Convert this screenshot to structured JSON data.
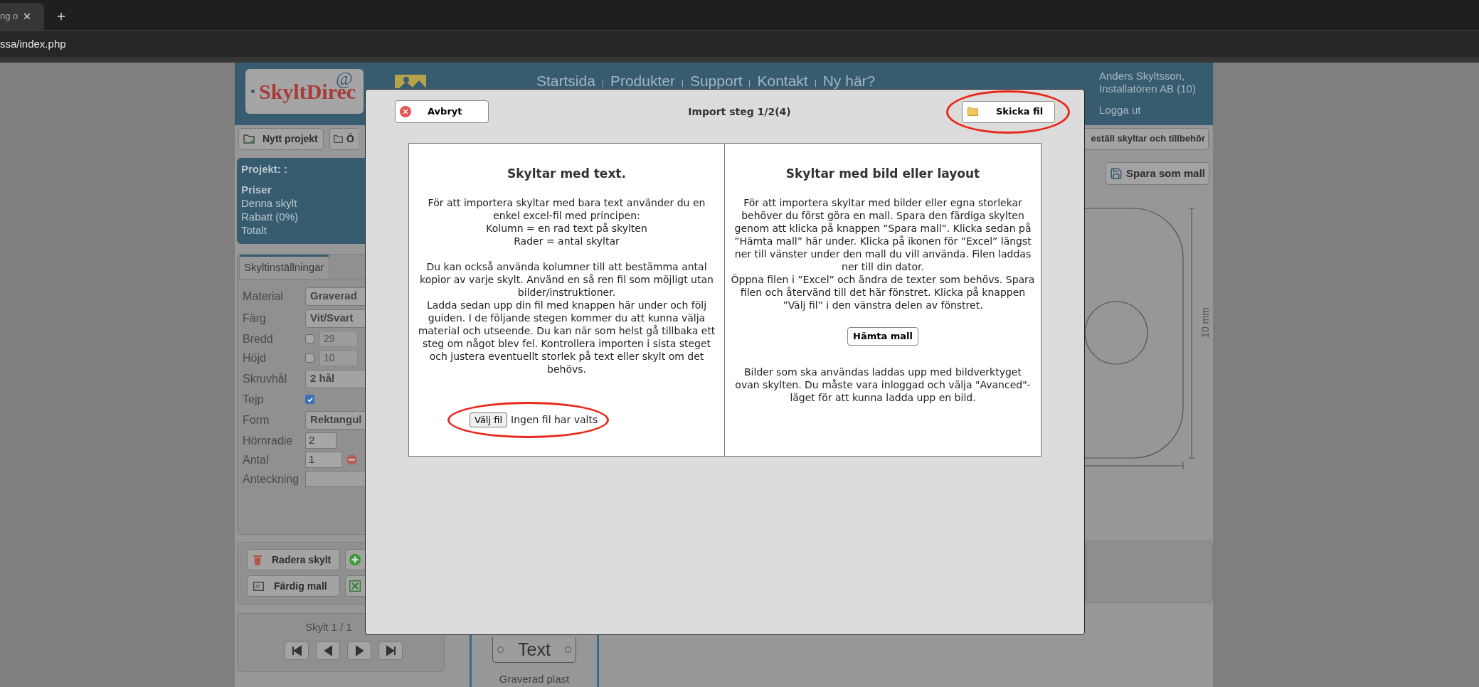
{
  "browser": {
    "tab_title": "ng o",
    "address": "ssa/index.php"
  },
  "header": {
    "logo": "SkyltDirec",
    "logo_mark": "@",
    "nav": [
      "Startsida",
      "Produkter",
      "Support",
      "Kontakt",
      "Ny här?"
    ],
    "user": [
      "Anders Skyltsson,",
      "Installatören AB (10)"
    ],
    "logout": "Logga ut"
  },
  "toolbar": {
    "left": [
      "Nytt projekt",
      "Ö"
    ],
    "right": "eställ skyltar och tillbehör"
  },
  "project": {
    "title": "Projekt: :",
    "prices_heading": "Priser",
    "price_rows": [
      "Denna skylt",
      "Rabatt (0%)",
      "Totalt"
    ]
  },
  "settings": {
    "tab": "Skyltinställningar",
    "rows": [
      {
        "label": "Material",
        "kind": "select",
        "value": "Graverad"
      },
      {
        "label": "Färg",
        "kind": "select",
        "value": "Vit/Svart"
      },
      {
        "label": "Bredd",
        "kind": "size",
        "checked": false,
        "value": "29"
      },
      {
        "label": "Höjd",
        "kind": "size",
        "checked": false,
        "value": "10"
      },
      {
        "label": "Skruvhål",
        "kind": "select",
        "value": "2 hål"
      },
      {
        "label": "Tejp",
        "kind": "checkbox",
        "checked": true
      },
      {
        "label": "Form",
        "kind": "select",
        "value": "Rektangul"
      },
      {
        "label": "Hörnradie",
        "kind": "input",
        "value": "2"
      },
      {
        "label": "Antal",
        "kind": "stepper",
        "value": "1"
      },
      {
        "label": "Anteckning",
        "kind": "text"
      }
    ]
  },
  "actions": [
    "Radera skylt",
    "Färdig mall"
  ],
  "pager": {
    "label": "Skylt 1 / 1"
  },
  "preview": {
    "sign_text": "Text",
    "material": "Graverad plast"
  },
  "right": {
    "save_template": "Spara som mall",
    "dimension": "10 mm"
  },
  "dialog": {
    "cancel": "Avbryt",
    "title": "Import steg 1/2(4)",
    "send": "Skicka fil",
    "left": {
      "heading": "Skyltar med text.",
      "blocks": [
        [
          "För att importera skyltar med bara text använder du en enkel excel-fil med principen:",
          "Kolumn = en rad text på skylten",
          "Rader = antal skyltar"
        ],
        [
          "Du kan också använda kolumner till att bestämma antal kopior av varje skylt. Använd en så ren fil som möjligt utan bilder/instruktioner.",
          "Ladda sedan upp din fil med knappen här under och följ guiden. I de följande stegen kommer du att kunna välja material och utseende. Du kan när som helst gå tillbaka ett steg om något blev fel. Kontrollera importen i sista steget och justera eventuellt storlek på text eller skylt om det behövs."
        ]
      ],
      "file_button": "Välj fil",
      "file_status": "Ingen fil har valts"
    },
    "right": {
      "heading": "Skyltar med bild eller layout",
      "blocks": [
        [
          "För att importera skyltar med bilder eller egna storlekar behöver du först göra en mall. Spara den färdiga skylten genom att klicka på knappen ”Spara mall”. Klicka sedan på ”Hämta mall” här under. Klicka på ikonen för ”Excel” längst ner till vänster under den mall du vill använda. Filen laddas ner till din dator.",
          "Öppna filen i ”Excel” och ändra de texter som behövs. Spara filen och återvänd till det här fönstret. Klicka på knappen ”Välj fil” i den vänstra delen av fönstret."
        ]
      ],
      "button": "Hämta mall",
      "footer": "Bilder som ska användas laddas upp med bildverktyget ovan skylten. Du måste vara inloggad och välja \"Avanced\"-läget för att kunna ladda upp en bild."
    }
  }
}
